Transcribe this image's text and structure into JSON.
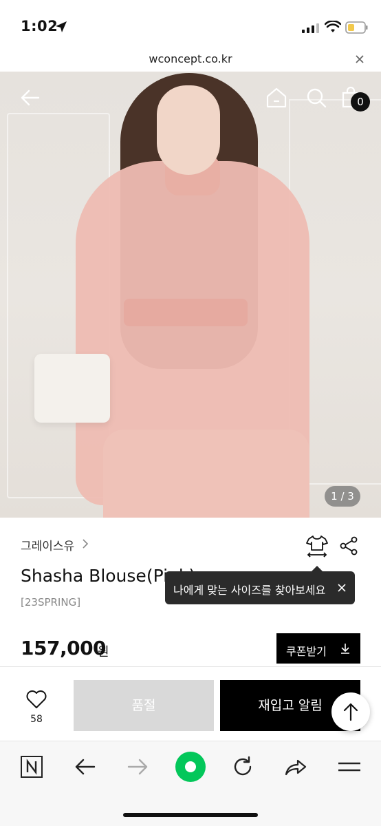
{
  "status_bar": {
    "time": "1:02"
  },
  "browser": {
    "url": "wconcept.co.kr"
  },
  "hero": {
    "cart_count": "0",
    "pager": "1 / 3"
  },
  "product": {
    "brand": "그레이스유",
    "title": "Shasha Blouse(Pink)",
    "season": "[23SPRING]",
    "price": "157,000",
    "currency": "원",
    "coupon_label": "쿠폰받기"
  },
  "tooltip": {
    "text": "나에게 맞는 사이즈를 찾아보세요"
  },
  "actions": {
    "like_count": "58",
    "soldout_label": "품절",
    "restock_label": "재입고 알림"
  },
  "colors": {
    "accent": "#000000",
    "soldout_bg": "#d9d9d9",
    "naver_green": "#03c75a",
    "battery": "#f2c94c"
  },
  "icons": [
    "back-arrow-icon",
    "home-icon",
    "search-icon",
    "shopping-bag-icon",
    "chevron-right-icon",
    "size-guide-icon",
    "share-icon",
    "close-icon",
    "download-icon",
    "heart-icon",
    "arrow-up-icon",
    "naver-n-icon",
    "reload-icon",
    "forward-share-icon",
    "menu-icon"
  ]
}
